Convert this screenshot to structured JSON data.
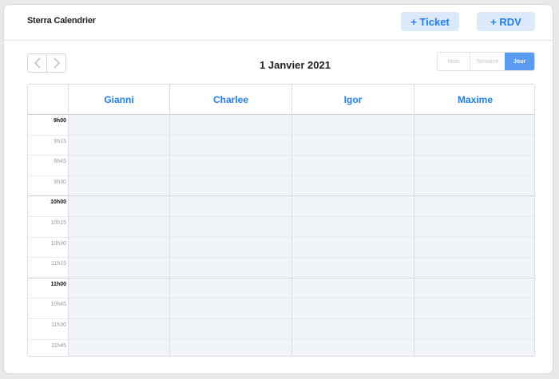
{
  "app": {
    "title": "Sterra Calendrier",
    "ticket_button": "+ Ticket",
    "rdv_button": "+ RDV"
  },
  "toolbar": {
    "prev_icon": "chevron-left-icon",
    "next_icon": "chevron-right-icon",
    "date": "1 Janvier 2021",
    "views": [
      "Mois",
      "Semaine",
      "Jour"
    ],
    "active_view": "Jour"
  },
  "calendar": {
    "columns": [
      "Gianni",
      "Charlee",
      "Igor",
      "Maxime"
    ],
    "time_slots": [
      {
        "label": "9h00",
        "hour": true
      },
      {
        "label": "9h15",
        "hour": false
      },
      {
        "label": "9h45",
        "hour": false
      },
      {
        "label": "9h30",
        "hour": false
      },
      {
        "label": "10h00",
        "hour": true
      },
      {
        "label": "10h15",
        "hour": false
      },
      {
        "label": "10h30",
        "hour": false
      },
      {
        "label": "11h15",
        "hour": false
      },
      {
        "label": "11h00",
        "hour": true
      },
      {
        "label": "10h45",
        "hour": false
      },
      {
        "label": "11h30",
        "hour": false
      },
      {
        "label": "11h45",
        "hour": false
      }
    ]
  },
  "colors": {
    "accent": "#1f7ff0",
    "button_bg": "#dbe9fb",
    "active_view_bg": "#5a9cf2",
    "slot_bg": "#f1f4f8"
  }
}
